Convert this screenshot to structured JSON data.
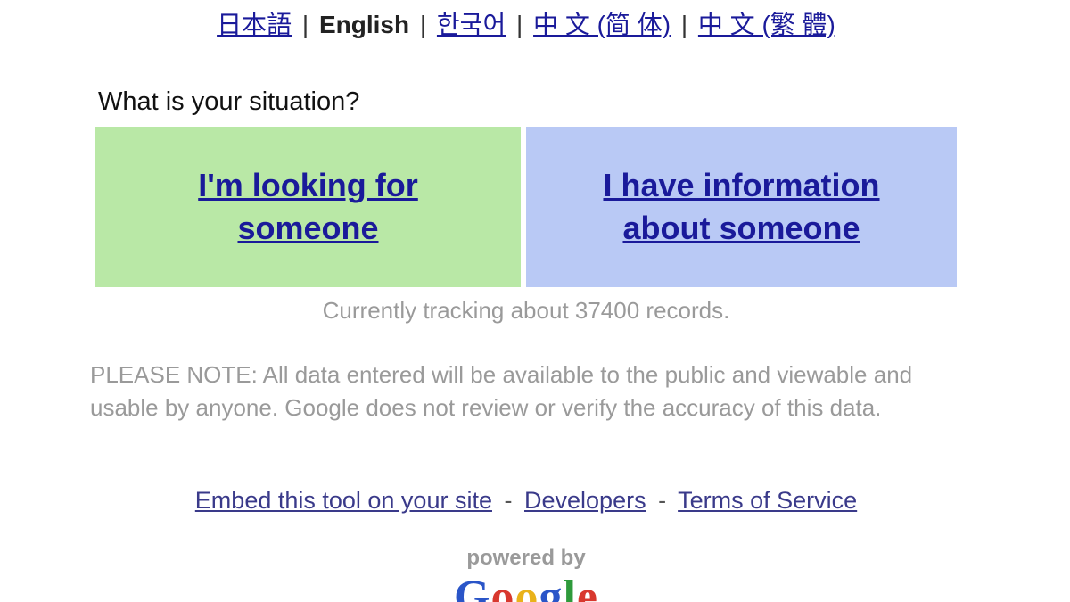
{
  "languages": {
    "japanese": "日本語",
    "english": "English",
    "korean": "한국어",
    "chinese_simplified": "中 文 (简 体)",
    "chinese_traditional": "中 文 (繁 體)",
    "separator": "|"
  },
  "question": "What is your situation?",
  "choices": {
    "looking_line1": "I'm looking for",
    "looking_line2": "someone",
    "info_line1": "I have information",
    "info_line2": "about someone"
  },
  "tracking": "Currently tracking about 37400 records.",
  "note": "PLEASE NOTE: All data entered will be available to the public and viewable and usable by anyone. Google does not review or verify the accuracy of this data.",
  "footer": {
    "embed": "Embed this tool on your site",
    "developers": "Developers",
    "terms": "Terms of Service",
    "dash": "-"
  },
  "powered_by": "powered by",
  "logo": {
    "letters": [
      "G",
      "o",
      "o",
      "g",
      "l",
      "e"
    ]
  },
  "colors": {
    "link": "#1a1a9a",
    "green_panel": "#b9e8a6",
    "blue_panel": "#b9c9f5",
    "muted_text": "#9a9a9a"
  }
}
